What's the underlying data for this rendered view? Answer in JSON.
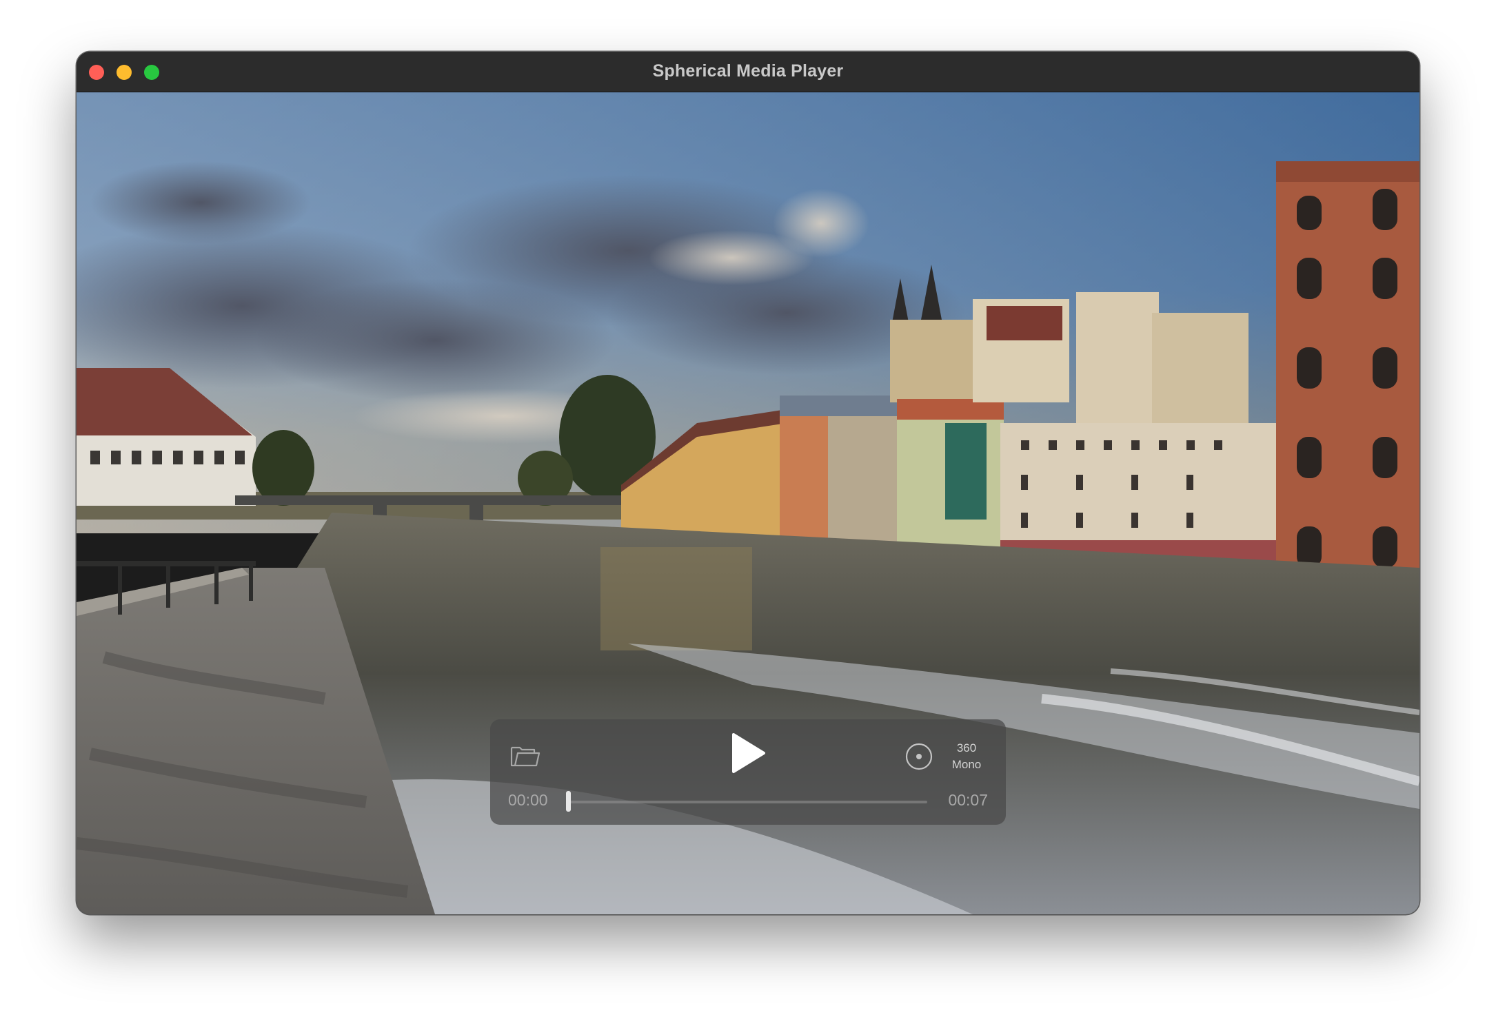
{
  "window": {
    "title": "Spherical Media Player"
  },
  "player": {
    "current_time": "00:00",
    "total_time": "00:07",
    "progress": 0.0,
    "projection": "360",
    "stereo_mode": "Mono"
  },
  "icons": {
    "open": "folder-icon",
    "play": "play-icon",
    "projection": "target-icon"
  },
  "colors": {
    "close": "#ff5f57",
    "minimize": "#febc2e",
    "zoom": "#28c840",
    "control_bar": "#484848"
  }
}
